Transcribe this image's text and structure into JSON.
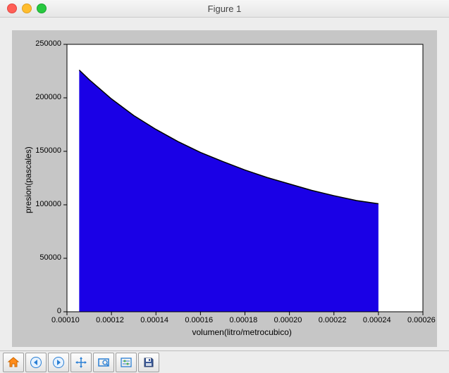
{
  "window": {
    "title": "Figure 1"
  },
  "toolbar": {
    "home": "Home",
    "back": "Back",
    "forward": "Forward",
    "pan": "Pan",
    "zoom": "Zoom",
    "subplots": "Configure subplots",
    "save": "Save"
  },
  "chart_data": {
    "type": "area",
    "xlabel": "volumen(litro/metrocubico)",
    "ylabel": "presion(pascales)",
    "xlim": [
      0.0001,
      0.00026
    ],
    "ylim": [
      0,
      250000
    ],
    "xticks": [
      0.0001,
      0.00012,
      0.00014,
      0.00016,
      0.00018,
      0.0002,
      0.00022,
      0.00024,
      0.00026
    ],
    "yticks": [
      0,
      50000,
      100000,
      150000,
      200000,
      250000
    ],
    "xtick_labels": [
      "0.00010",
      "0.00012",
      "0.00014",
      "0.00016",
      "0.00018",
      "0.00020",
      "0.00022",
      "0.00024",
      "0.00026"
    ],
    "ytick_labels": [
      "0",
      "50000",
      "100000",
      "150000",
      "200000",
      "250000"
    ],
    "series": [
      {
        "name": "presion",
        "fill_color": "#1a00e6",
        "line_color": "#000000",
        "x": [
          0.0001055,
          0.00011,
          0.00012,
          0.00013,
          0.00014,
          0.00015,
          0.00016,
          0.00017,
          0.00018,
          0.00019,
          0.0002,
          0.00021,
          0.00022,
          0.00023,
          0.00024
        ],
        "y": [
          226000,
          217000,
          199000,
          183500,
          170500,
          159000,
          149000,
          140500,
          132500,
          125500,
          119500,
          113500,
          108500,
          104000,
          101000
        ]
      }
    ]
  }
}
